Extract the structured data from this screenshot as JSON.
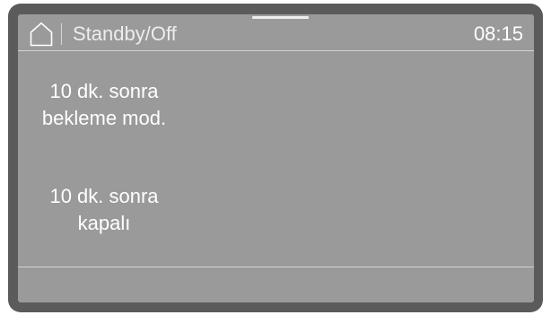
{
  "header": {
    "home_icon": "home-icon",
    "title": "Standby/Off",
    "time": "08:15"
  },
  "options": [
    {
      "line1": "10 dk. sonra",
      "line2": "bekleme mod."
    },
    {
      "line1": "10 dk. sonra",
      "line2": "kapalı"
    }
  ],
  "colors": {
    "bezel": "#5b5b5c",
    "screen": "#9a9a9b",
    "text": "#ffffff"
  }
}
